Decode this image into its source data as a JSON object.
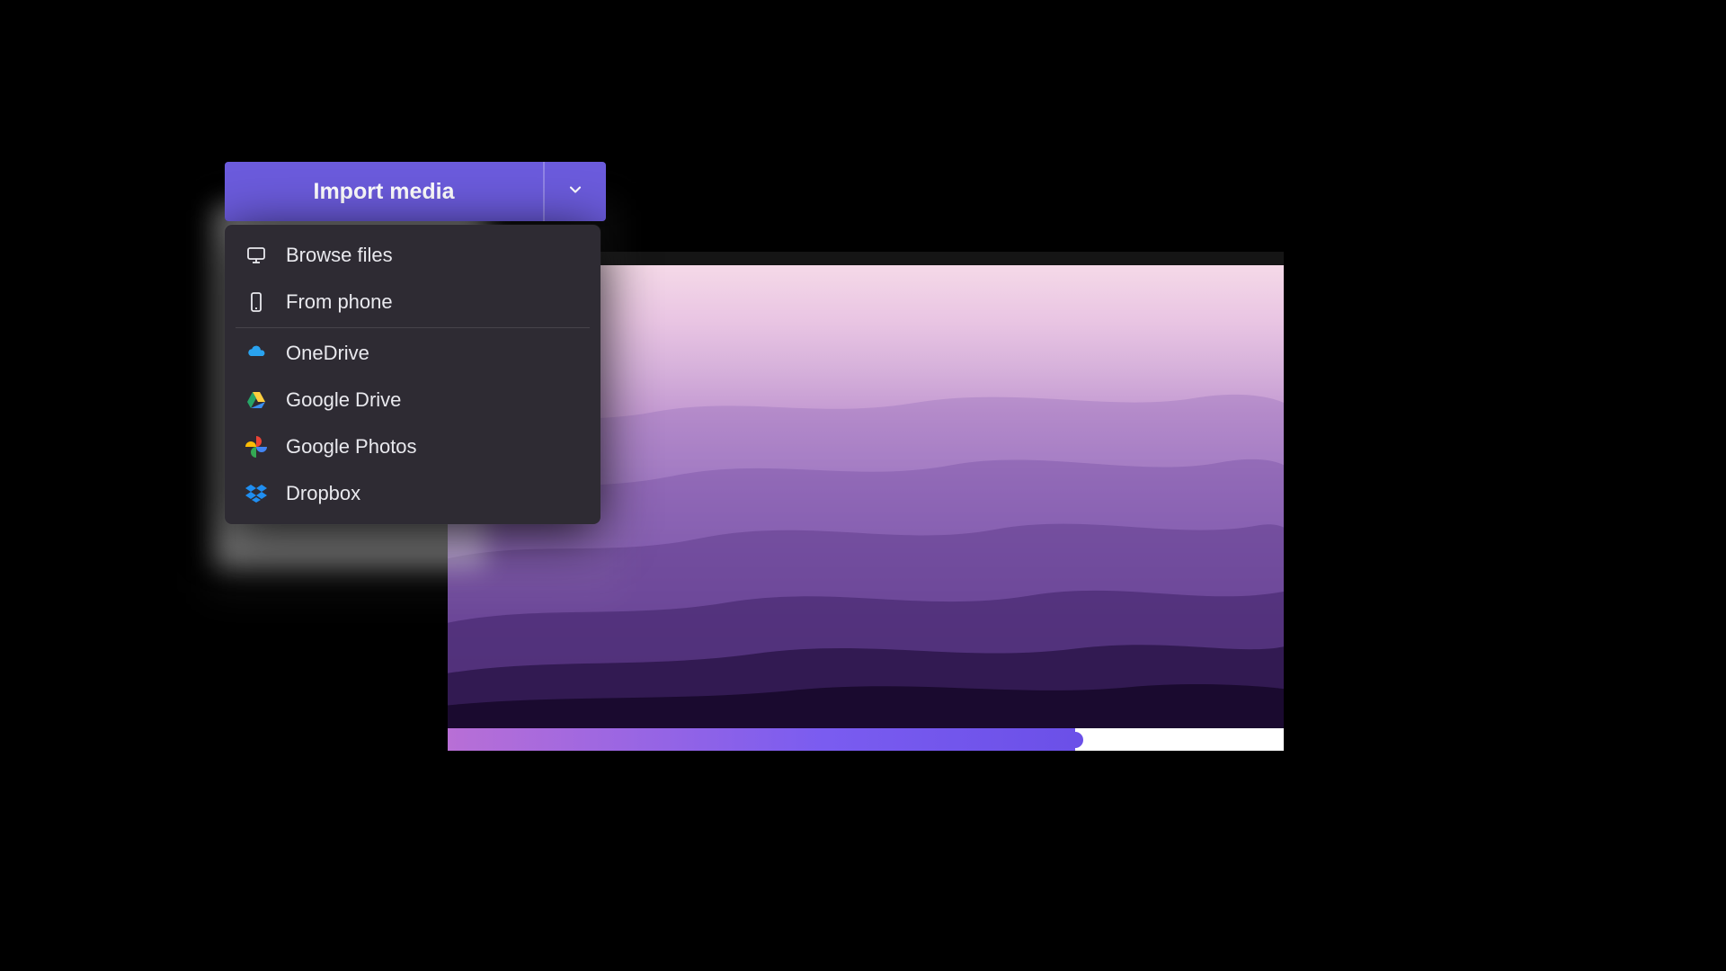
{
  "import": {
    "button_label": "Import media",
    "caret_icon": "chevron-down"
  },
  "dropdown": {
    "items": [
      {
        "icon": "monitor",
        "label": "Browse files"
      },
      {
        "icon": "phone",
        "label": "From phone"
      },
      {
        "sep": true
      },
      {
        "icon": "onedrive",
        "label": "OneDrive"
      },
      {
        "icon": "google-drive",
        "label": "Google Drive"
      },
      {
        "icon": "google-photos",
        "label": "Google Photos"
      },
      {
        "icon": "dropbox",
        "label": "Dropbox"
      }
    ]
  },
  "preview": {
    "description": "purple layered mountain landscape",
    "progress_percent": 75
  },
  "colors": {
    "accent": "#6b5bdc",
    "panel": "#2e2b33"
  }
}
